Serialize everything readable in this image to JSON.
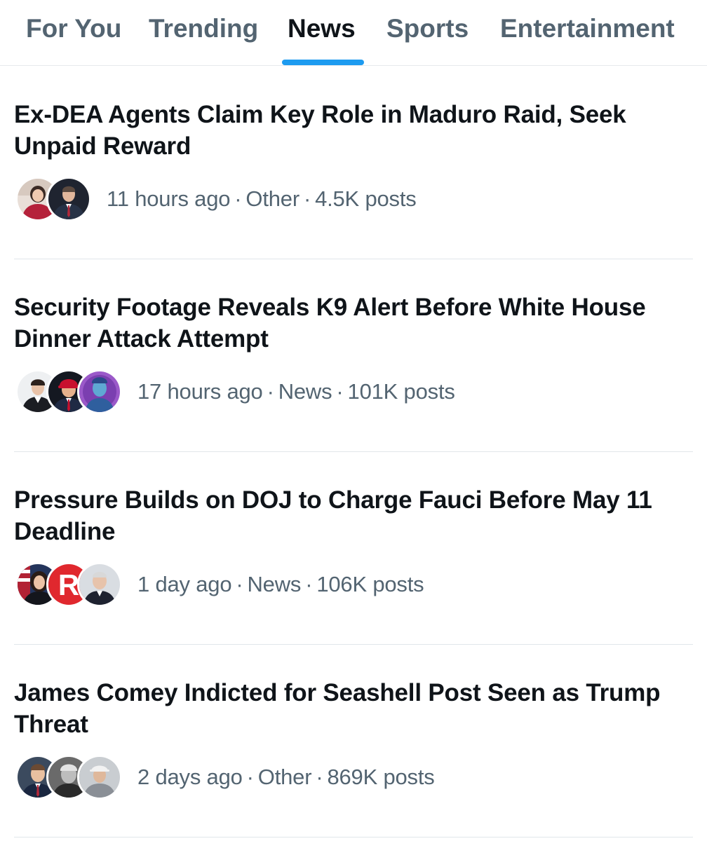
{
  "tabs": [
    {
      "label": "For You",
      "active": false
    },
    {
      "label": "Trending",
      "active": false
    },
    {
      "label": "News",
      "active": true
    },
    {
      "label": "Sports",
      "active": false
    },
    {
      "label": "Entertainment",
      "active": false
    }
  ],
  "accent_color": "#1d9bf0",
  "separator": "·",
  "stories": [
    {
      "headline": "Ex-DEA Agents Claim Key Role in Maduro Raid, Seek Unpaid Reward",
      "time": "11 hours ago",
      "category": "Other",
      "posts": "4.5K posts",
      "avatar_count": 2
    },
    {
      "headline": "Security Footage Reveals K9 Alert Before White House Dinner Attack Attempt",
      "time": "17 hours ago",
      "category": "News",
      "posts": "101K posts",
      "avatar_count": 3
    },
    {
      "headline": "Pressure Builds on DOJ to Charge Fauci Before May 11 Deadline",
      "time": "1 day ago",
      "category": "News",
      "posts": "106K posts",
      "avatar_count": 3,
      "logo_letter": "R"
    },
    {
      "headline": "James Comey Indicted for Seashell Post Seen as Trump Threat",
      "time": "2 days ago",
      "category": "Other",
      "posts": "869K posts",
      "avatar_count": 3
    }
  ]
}
